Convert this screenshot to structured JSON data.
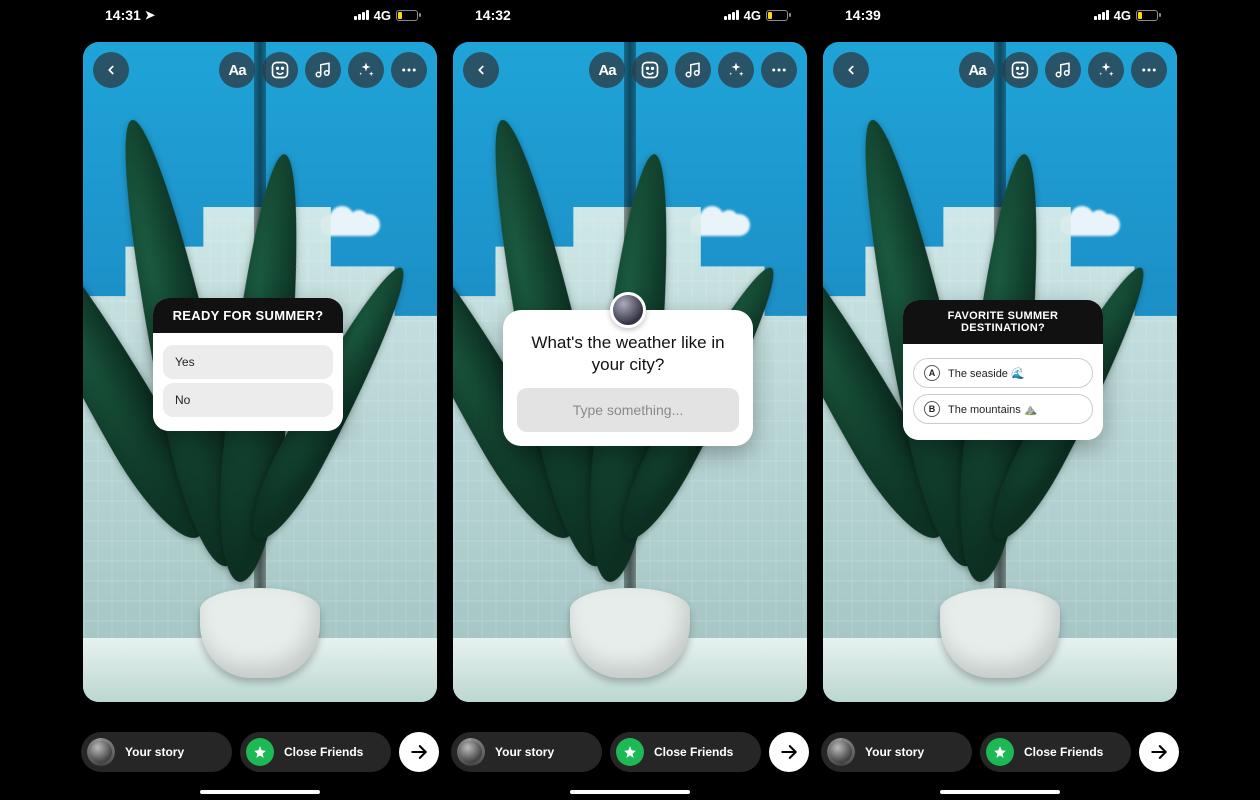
{
  "screens": [
    {
      "status": {
        "time": "14:31",
        "loc_arrow": true,
        "network": "4G",
        "battery": "19"
      },
      "sticker": {
        "type": "poll",
        "title": "READY FOR SUMMER?",
        "options": [
          "Yes",
          "No"
        ]
      }
    },
    {
      "status": {
        "time": "14:32",
        "loc_arrow": false,
        "network": "4G",
        "battery": "19"
      },
      "sticker": {
        "type": "question",
        "prompt": "What's the weather like in your city?",
        "placeholder": "Type something..."
      }
    },
    {
      "status": {
        "time": "14:39",
        "loc_arrow": false,
        "network": "4G",
        "battery": "17"
      },
      "sticker": {
        "type": "quiz",
        "title": "FAVORITE SUMMER DESTINATION?",
        "options": [
          {
            "letter": "A",
            "label": "The seaside 🌊"
          },
          {
            "letter": "B",
            "label": "The mountains ⛰️"
          }
        ]
      }
    }
  ],
  "bottom": {
    "your_story": "Your story",
    "close_friends": "Close Friends"
  },
  "toolbar_icons": [
    "text",
    "sticker",
    "music",
    "effects",
    "more"
  ]
}
